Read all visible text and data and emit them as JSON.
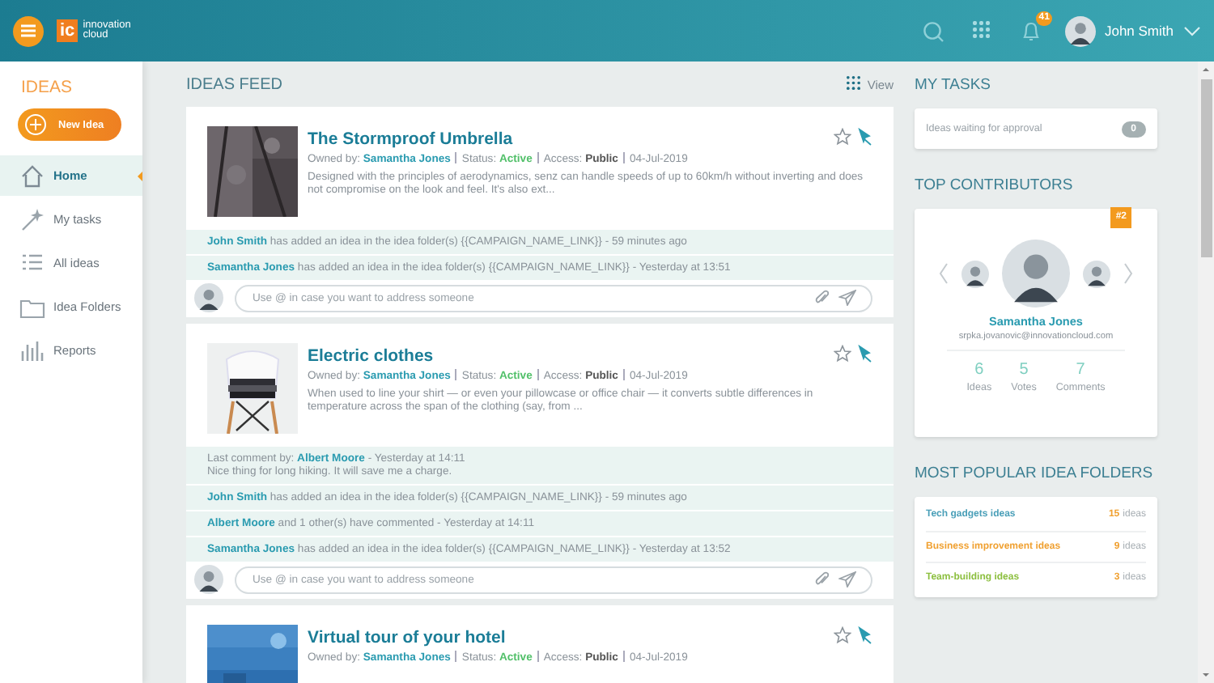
{
  "header": {
    "logo_mark": "ic",
    "logo_text": "innovation cloud",
    "notification_count": "41",
    "user_name": "John Smith"
  },
  "sidebar": {
    "title": "IDEAS",
    "new_button": "New Idea",
    "items": [
      {
        "label": "Home",
        "selected": true
      },
      {
        "label": "My tasks",
        "selected": false
      },
      {
        "label": "All ideas",
        "selected": false
      },
      {
        "label": "Idea Folders",
        "selected": false
      },
      {
        "label": "Reports",
        "selected": false
      }
    ]
  },
  "feed": {
    "title": "IDEAS FEED",
    "view_label": "View",
    "ideas": [
      {
        "title": "The Stormproof Umbrella",
        "owner_label": "Owned by:",
        "owner": "Samantha Jones",
        "status_label": "Status:",
        "status": "Active",
        "access_label": "Access:",
        "access": "Public",
        "date": "04-Jul-2019",
        "description": "Designed with the principles of aerodynamics, senz can handle speeds of up to 60km/h without inverting and does not compromise on the look and feel. It's also ext...",
        "activities": [
          {
            "actor": "John Smith",
            "text": "has added an idea in the idea folder(s) {{CAMPAIGN_NAME_LINK}} - 59 minutes ago"
          },
          {
            "actor": "Samantha Jones",
            "text": "has added an idea in the idea folder(s) {{CAMPAIGN_NAME_LINK}} - Yesterday at 13:51"
          }
        ],
        "placeholder": "Use @ in case you want to address someone"
      },
      {
        "title": "Electric clothes",
        "owner_label": "Owned by:",
        "owner": "Samantha Jones",
        "status_label": "Status:",
        "status": "Active",
        "access_label": "Access:",
        "access": "Public",
        "date": "04-Jul-2019",
        "description": "When used to line your shirt — or even your pillowcase or office chair — it converts subtle differences in temperature across the span of the clothing (say, from ...",
        "last_comment": {
          "label": "Last comment by:",
          "author": "Albert Moore",
          "time": "- Yesterday at 14:11",
          "text": "Nice thing for long hiking. It will save me a charge."
        },
        "activities": [
          {
            "actor": "John Smith",
            "text": "has added an idea in the idea folder(s) {{CAMPAIGN_NAME_LINK}} - 59 minutes ago"
          },
          {
            "actor": "Albert Moore",
            "text": "and 1 other(s) have commented - Yesterday at 14:11"
          },
          {
            "actor": "Samantha Jones",
            "text": "has added an idea in the idea folder(s) {{CAMPAIGN_NAME_LINK}} - Yesterday at 13:52"
          }
        ],
        "placeholder": "Use @ in case you want to address someone"
      },
      {
        "title": "Virtual tour of your hotel",
        "owner_label": "Owned by:",
        "owner": "Samantha Jones",
        "status_label": "Status:",
        "status": "Active",
        "access_label": "Access:",
        "access": "Public",
        "date": "04-Jul-2019"
      }
    ]
  },
  "tasks": {
    "title": "MY TASKS",
    "items": [
      {
        "label": "Ideas waiting for approval",
        "count": "0"
      }
    ]
  },
  "contributors": {
    "title": "TOP CONTRIBUTORS",
    "rank": "#2",
    "name": "Samantha Jones",
    "email": "srpka.jovanovic@innovationcloud.com",
    "stats": [
      {
        "value": "6",
        "label": "Ideas"
      },
      {
        "value": "5",
        "label": "Votes"
      },
      {
        "value": "7",
        "label": "Comments"
      }
    ]
  },
  "folders": {
    "title": "MOST POPULAR IDEA FOLDERS",
    "items": [
      {
        "name": "Tech gadgets ideas",
        "color": "#4a9fb8",
        "count": "15",
        "unit": "ideas"
      },
      {
        "name": "Business improvement ideas",
        "color": "#f0a030",
        "count": "9",
        "unit": "ideas"
      },
      {
        "name": "Team-building ideas",
        "color": "#8cbf3f",
        "count": "3",
        "unit": "ideas"
      }
    ]
  }
}
